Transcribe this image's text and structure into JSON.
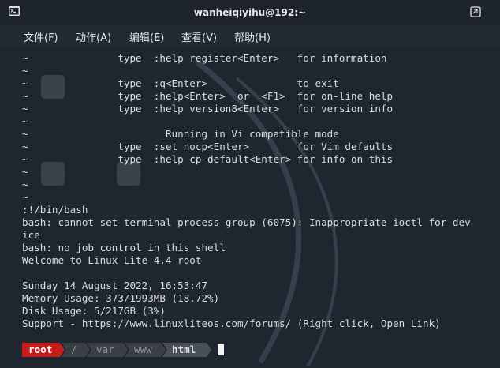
{
  "window": {
    "title": "wanheiqiyihu@192:~"
  },
  "menu": [
    {
      "id": "file",
      "label": "文件(F)"
    },
    {
      "id": "action",
      "label": "动作(A)"
    },
    {
      "id": "edit",
      "label": "编辑(E)"
    },
    {
      "id": "view",
      "label": "查看(V)"
    },
    {
      "id": "help",
      "label": "帮助(H)"
    }
  ],
  "terminal": {
    "lines": [
      "~               type  :help register<Enter>   for information",
      "~",
      "~               type  :q<Enter>               to exit",
      "~               type  :help<Enter>  or  <F1>  for on-line help",
      "~               type  :help version8<Enter>   for version info",
      "~",
      "~                       Running in Vi compatible mode",
      "~               type  :set nocp<Enter>        for Vim defaults",
      "~               type  :help cp-default<Enter> for info on this",
      "~",
      "~",
      "~",
      ":!/bin/bash",
      "bash: cannot set terminal process group (6075): Inappropriate ioctl for dev",
      "ice",
      "bash: no job control in this shell",
      "Welcome to Linux Lite 4.4 root",
      "",
      "Sunday 14 August 2022, 16:53:47",
      "Memory Usage: 373/1993MB (18.72%)",
      "Disk Usage: 5/217GB (3%)",
      "Support - https://www.linuxliteos.com/forums/ (Right click, Open Link)"
    ],
    "prompt": {
      "user": "root",
      "path": [
        "/",
        "var",
        "www",
        "html"
      ]
    }
  },
  "colors": {
    "terminal_bg": "#1e262e",
    "prompt_user_bg": "#c41b1b",
    "prompt_path_bg": "#3a3f46",
    "prompt_current_bg": "#4a5058"
  },
  "icons": [
    "terminal-icon",
    "restore-window-icon"
  ]
}
